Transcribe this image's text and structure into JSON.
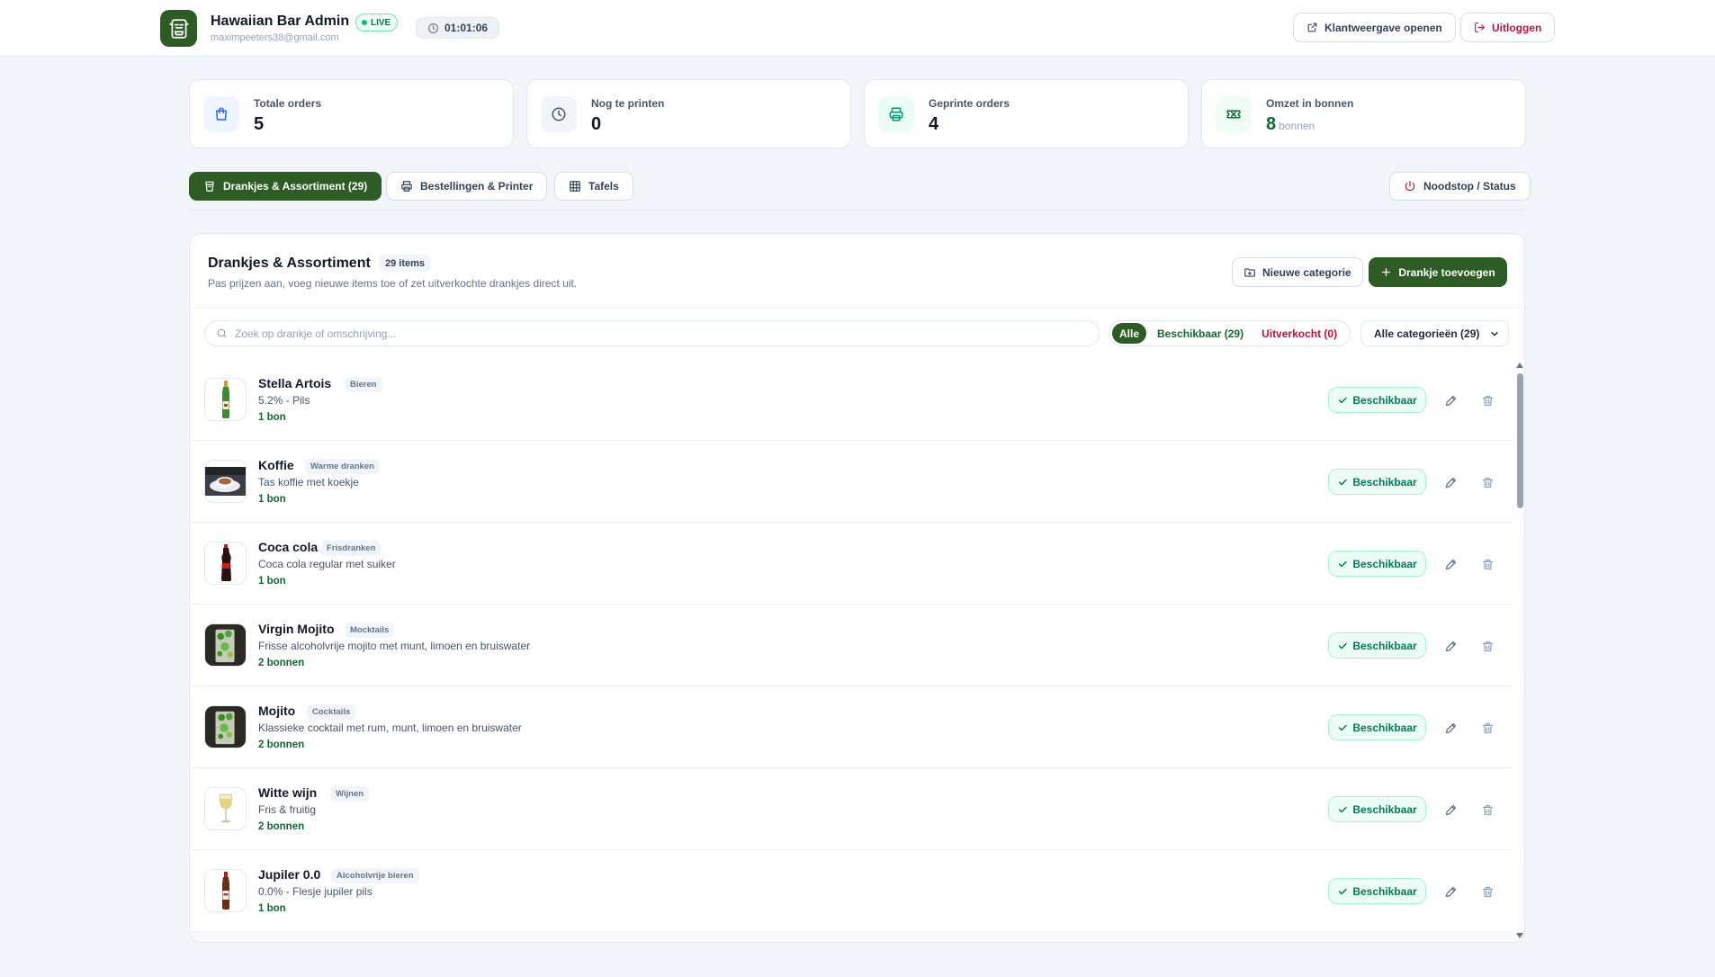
{
  "header": {
    "title": "Hawaiian Bar Admin",
    "live_label": "LIVE",
    "email": "maximpeeters38@gmail.com",
    "timer": "01:01:06",
    "open_client_label": "Klantweergave openen",
    "logout_label": "Uitloggen"
  },
  "stats": [
    {
      "label": "Totale orders",
      "value": "5",
      "unit": ""
    },
    {
      "label": "Nog te printen",
      "value": "0",
      "unit": ""
    },
    {
      "label": "Geprinte orders",
      "value": "4",
      "unit": ""
    },
    {
      "label": "Omzet in bonnen",
      "value": "8",
      "unit": "bonnen"
    }
  ],
  "tabs": [
    {
      "label": "Drankjes & Assortiment (29)",
      "active": true
    },
    {
      "label": "Bestellingen & Printer",
      "active": false
    },
    {
      "label": "Tafels",
      "active": false
    }
  ],
  "emergency_label": "Noodstop / Status",
  "panel": {
    "title": "Drankjes & Assortiment",
    "count": "29 items",
    "subtitle": "Pas prijzen aan, voeg nieuwe items toe of zet uitverkochte drankjes direct uit.",
    "new_category_label": "Nieuwe categorie",
    "add_drink_label": "Drankje toevoegen",
    "search_placeholder": "Zoek op drankje of omschrijving...",
    "filters": {
      "all": "Alle",
      "available": "Beschikbaar (29)",
      "sold_out": "Uitverkocht (0)"
    },
    "category_select": "Alle categorieën (29)"
  },
  "items": [
    {
      "name": "Stella Artois",
      "category": "Bieren",
      "description": "5.2% - Pils",
      "price": "1 bon",
      "status": "Beschikbaar",
      "thumb": "beer-bottle"
    },
    {
      "name": "Koffie",
      "category": "Warme dranken",
      "description": "Tas koffie met koekje",
      "price": "1 bon",
      "status": "Beschikbaar",
      "thumb": "coffee-cup"
    },
    {
      "name": "Coca cola",
      "category": "Frisdranken",
      "description": "Coca cola regular met suiker",
      "price": "1 bon",
      "status": "Beschikbaar",
      "thumb": "cola-bottle"
    },
    {
      "name": "Virgin Mojito",
      "category": "Mocktails",
      "description": "Frisse alcoholvrije mojito met munt, limoen en bruiswater",
      "price": "2 bonnen",
      "status": "Beschikbaar",
      "thumb": "mojito-glass"
    },
    {
      "name": "Mojito",
      "category": "Cocktails",
      "description": "Klassieke cocktail met rum, munt, limoen en bruiswater",
      "price": "2 bonnen",
      "status": "Beschikbaar",
      "thumb": "mojito-glass"
    },
    {
      "name": "Witte wijn",
      "category": "Wijnen",
      "description": "Fris & fruitig",
      "price": "2 bonnen",
      "status": "Beschikbaar",
      "thumb": "wine-glass"
    },
    {
      "name": "Jupiler 0.0",
      "category": "Alcoholvrije bieren",
      "description": "0.0% - Flesje jupiler pils",
      "price": "1 bon",
      "status": "Beschikbaar",
      "thumb": "beer-bottle-brown"
    }
  ],
  "colors": {
    "brand": "#2d5d24",
    "accent_green": "#047857",
    "sold_out_red": "#be123c"
  }
}
